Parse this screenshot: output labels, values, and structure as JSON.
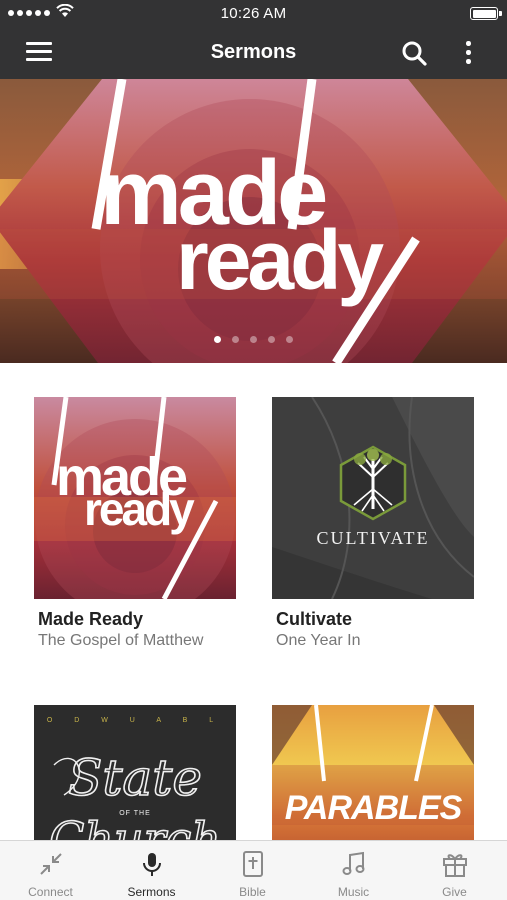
{
  "status_bar": {
    "time": "10:26 AM"
  },
  "nav": {
    "title": "Sermons"
  },
  "hero": {
    "title_line1": "made",
    "title_line2": "ready",
    "page_count": 5,
    "active_page": 1
  },
  "cards": [
    {
      "title": "Made Ready",
      "subtitle": "The Gospel of Matthew",
      "art_line1": "made",
      "art_line2": "ready"
    },
    {
      "title": "Cultivate",
      "subtitle": "One Year In",
      "art_text": "CULTIVATE"
    },
    {
      "title": "",
      "subtitle": "",
      "art_top": "O D W U A B L",
      "art_line1": "State",
      "art_small": "OF THE",
      "art_line2": "Church"
    },
    {
      "title": "",
      "subtitle": "",
      "art_text": "PARABLES"
    }
  ],
  "tabs": [
    {
      "label": "Connect",
      "icon": "arrows-collapse-icon",
      "active": false
    },
    {
      "label": "Sermons",
      "icon": "microphone-icon",
      "active": true
    },
    {
      "label": "Bible",
      "icon": "bible-icon",
      "active": false
    },
    {
      "label": "Music",
      "icon": "music-note-icon",
      "active": false
    },
    {
      "label": "Give",
      "icon": "gift-icon",
      "active": false
    }
  ],
  "colors": {
    "bar": "#333334",
    "tab_active": "#2a2a2a",
    "tab_inactive": "#8a8a8a"
  }
}
